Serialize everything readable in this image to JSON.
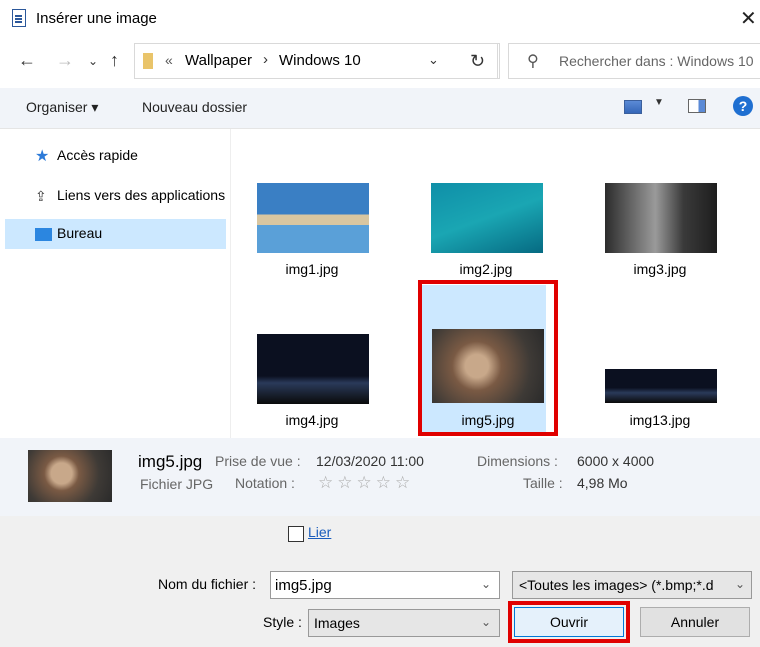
{
  "window": {
    "title": "Insérer une image"
  },
  "nav": {
    "path_overflow": "«",
    "path": [
      "Wallpaper",
      "Windows 10"
    ],
    "search_placeholder": "Rechercher dans : Windows 10"
  },
  "toolbar": {
    "organise_label": "Organiser ▾",
    "new_folder_label": "Nouveau dossier",
    "help": "?"
  },
  "sidebar": {
    "items": [
      {
        "label": "Accès rapide",
        "icon": "star-icon"
      },
      {
        "label": "Liens vers des applications",
        "icon": "share-icon"
      },
      {
        "label": "Bureau",
        "icon": "desktop-icon",
        "selected": true
      }
    ]
  },
  "files": [
    {
      "name": "img1.jpg",
      "colors": [
        "#3a7fc4",
        "#d9c6a0"
      ]
    },
    {
      "name": "img2.jpg",
      "colors": [
        "#0f8fa8",
        "#1aa6b3"
      ]
    },
    {
      "name": "img3.jpg",
      "colors": [
        "#2c2c2c",
        "#9a9a9a"
      ]
    },
    {
      "name": "img4.jpg",
      "colors": [
        "#0b1020",
        "#2a3a5a"
      ]
    },
    {
      "name": "img5.jpg",
      "colors": [
        "#3e3a36",
        "#c8a88a"
      ],
      "selected": true
    },
    {
      "name": "img13.jpg",
      "colors": [
        "#0b1020",
        "#2a3a5a"
      ]
    }
  ],
  "details": {
    "name": "img5.jpg",
    "type": "Fichier JPG",
    "taken_label": "Prise de vue :",
    "taken_value": "12/03/2020 11:00",
    "rating_label": "Notation :",
    "rating_stars": "☆☆☆☆☆",
    "dimensions_label": "Dimensions :",
    "dimensions_value": "6000 x 4000",
    "size_label": "Taille :",
    "size_value": "4,98 Mo"
  },
  "bottom": {
    "link_label": "Lier",
    "filename_label": "Nom du fichier :",
    "filename_value": "img5.jpg",
    "filter_value": "<Toutes les images> (*.bmp;*.d",
    "style_label": "Style :",
    "style_value": "Images",
    "open_label": "Ouvrir",
    "cancel_label": "Annuler"
  },
  "colors": {
    "accent": "#0078d7",
    "selection": "#cce8ff",
    "highlight": "#e00000"
  }
}
